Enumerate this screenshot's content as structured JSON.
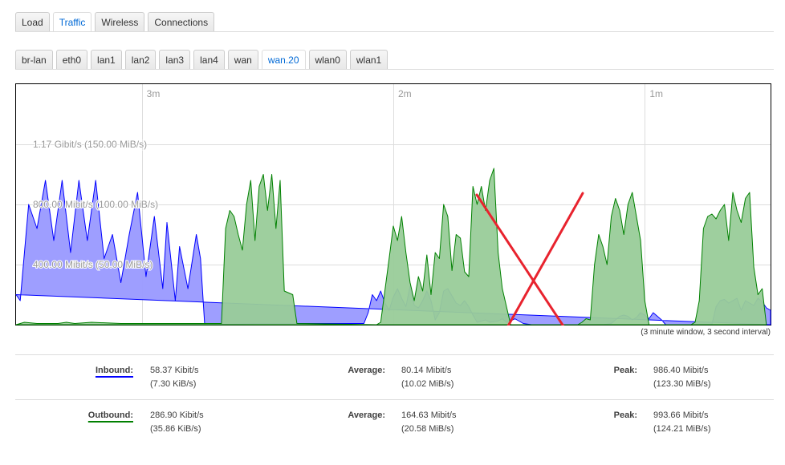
{
  "main_tabs": [
    "Load",
    "Traffic",
    "Wireless",
    "Connections"
  ],
  "main_active": "Traffic",
  "iface_tabs": [
    "br-lan",
    "eth0",
    "lan1",
    "lan2",
    "lan3",
    "lan4",
    "wan",
    "wan.20",
    "wlan0",
    "wlan1"
  ],
  "iface_active": "wan.20",
  "graph": {
    "caption": "(3 minute window, 3 second interval)",
    "colors": {
      "inbound_fill": "#9999ff",
      "inbound_line": "#0000ff",
      "outbound_fill": "#99cc99",
      "outbound_line": "#008000",
      "overlay_x": "#e8232e"
    }
  },
  "chart_data": {
    "type": "area",
    "x_unit": "seconds ago",
    "xlim": [
      180,
      0
    ],
    "x_ticks": [
      {
        "value": 150,
        "label": "3m"
      },
      {
        "value": 90,
        "label": "2m"
      },
      {
        "value": 30,
        "label": "1m"
      }
    ],
    "y_unit": "MiB/s",
    "ylim": [
      0,
      200
    ],
    "y_ticks": [
      {
        "value": 150,
        "label": "1.17 Gibit/s (150.00 MiB/s)"
      },
      {
        "value": 100,
        "label": "800.00 Mibit/s (100.00 MiB/s)"
      },
      {
        "value": 50,
        "label": "400.00 Mibit/s (50.00 MiB/s)"
      }
    ],
    "series": [
      {
        "name": "Inbound",
        "points": [
          [
            180,
            25
          ],
          [
            179,
            20
          ],
          [
            177,
            100
          ],
          [
            175,
            80
          ],
          [
            173,
            120
          ],
          [
            171,
            70
          ],
          [
            169,
            120
          ],
          [
            167,
            60
          ],
          [
            165,
            120
          ],
          [
            163,
            70
          ],
          [
            161,
            120
          ],
          [
            159,
            55
          ],
          [
            157,
            75
          ],
          [
            155,
            35
          ],
          [
            153,
            75
          ],
          [
            151,
            110
          ],
          [
            149,
            40
          ],
          [
            147,
            90
          ],
          [
            145,
            30
          ],
          [
            144,
            85
          ],
          [
            142,
            20
          ],
          [
            141,
            65
          ],
          [
            139,
            30
          ],
          [
            137,
            75
          ],
          [
            136,
            55
          ],
          [
            135,
            0
          ],
          [
            123,
            1
          ],
          [
            113,
            1
          ],
          [
            103,
            1
          ],
          [
            97,
            1
          ],
          [
            96,
            10
          ],
          [
            95,
            25
          ],
          [
            94,
            20
          ],
          [
            93,
            28
          ],
          [
            92,
            18
          ],
          [
            91,
            12
          ],
          [
            90,
            23
          ],
          [
            89,
            30
          ],
          [
            88,
            22
          ],
          [
            87,
            15
          ],
          [
            86,
            32
          ],
          [
            85,
            16
          ],
          [
            84,
            14
          ],
          [
            83,
            20
          ],
          [
            82,
            28
          ],
          [
            81,
            20
          ],
          [
            80,
            4
          ],
          [
            79,
            10
          ],
          [
            78,
            28
          ],
          [
            77,
            30
          ],
          [
            76,
            24
          ],
          [
            75,
            18
          ],
          [
            74,
            16
          ],
          [
            73,
            20
          ],
          [
            72,
            15
          ],
          [
            71,
            8
          ],
          [
            70,
            2
          ],
          [
            69,
            3
          ],
          [
            68,
            4
          ],
          [
            67,
            2
          ],
          [
            65,
            3
          ],
          [
            64,
            5
          ],
          [
            63,
            2
          ],
          [
            62,
            3
          ],
          [
            61,
            5
          ],
          [
            60,
            3
          ],
          [
            59,
            1
          ],
          [
            57,
            0
          ],
          [
            40,
            0
          ],
          [
            38,
            1
          ],
          [
            37,
            4
          ],
          [
            36,
            7
          ],
          [
            35,
            8
          ],
          [
            34,
            7
          ],
          [
            33,
            4
          ],
          [
            32,
            6
          ],
          [
            31,
            10
          ],
          [
            30,
            8
          ],
          [
            29,
            5
          ],
          [
            28,
            10
          ],
          [
            27,
            7
          ],
          [
            26,
            4
          ],
          [
            25,
            0
          ],
          [
            14,
            0
          ],
          [
            13,
            15
          ],
          [
            12,
            20
          ],
          [
            11,
            21
          ],
          [
            10,
            18
          ],
          [
            9,
            20
          ],
          [
            8,
            22
          ],
          [
            7,
            12
          ],
          [
            6,
            20
          ],
          [
            5,
            18
          ],
          [
            4,
            16
          ],
          [
            3,
            22
          ],
          [
            2,
            19
          ],
          [
            1,
            14
          ],
          [
            0,
            12
          ],
          [
            0,
            0
          ]
        ]
      },
      {
        "name": "Outbound",
        "points": [
          [
            180,
            0
          ],
          [
            178,
            2
          ],
          [
            175,
            1
          ],
          [
            170,
            1
          ],
          [
            168,
            2
          ],
          [
            166,
            1
          ],
          [
            162,
            2
          ],
          [
            155,
            1
          ],
          [
            153,
            1
          ],
          [
            131,
            1
          ],
          [
            130,
            80
          ],
          [
            129,
            95
          ],
          [
            128,
            90
          ],
          [
            127,
            75
          ],
          [
            126,
            62
          ],
          [
            125,
            100
          ],
          [
            124,
            120
          ],
          [
            123,
            70
          ],
          [
            122,
            115
          ],
          [
            121,
            125
          ],
          [
            120,
            95
          ],
          [
            119,
            125
          ],
          [
            118,
            80
          ],
          [
            117,
            120
          ],
          [
            116,
            28
          ],
          [
            114,
            25
          ],
          [
            113,
            1
          ],
          [
            94,
            0
          ],
          [
            93,
            2
          ],
          [
            91,
            55
          ],
          [
            90,
            82
          ],
          [
            89,
            70
          ],
          [
            88,
            90
          ],
          [
            87,
            60
          ],
          [
            86,
            35
          ],
          [
            85,
            20
          ],
          [
            84,
            40
          ],
          [
            83,
            28
          ],
          [
            82,
            58
          ],
          [
            81,
            25
          ],
          [
            80,
            60
          ],
          [
            79,
            55
          ],
          [
            78,
            100
          ],
          [
            77,
            90
          ],
          [
            76,
            45
          ],
          [
            75,
            75
          ],
          [
            74,
            72
          ],
          [
            73,
            44
          ],
          [
            72,
            40
          ],
          [
            71,
            115
          ],
          [
            70,
            100
          ],
          [
            69,
            115
          ],
          [
            68,
            95
          ],
          [
            67,
            120
          ],
          [
            66,
            130
          ],
          [
            65,
            60
          ],
          [
            64,
            30
          ],
          [
            63,
            15
          ],
          [
            62,
            0
          ],
          [
            46,
            0
          ],
          [
            45,
            2
          ],
          [
            44,
            5
          ],
          [
            43,
            4
          ],
          [
            42,
            50
          ],
          [
            41,
            75
          ],
          [
            40,
            65
          ],
          [
            39,
            50
          ],
          [
            38,
            90
          ],
          [
            37,
            105
          ],
          [
            36,
            95
          ],
          [
            35,
            75
          ],
          [
            34,
            100
          ],
          [
            33,
            110
          ],
          [
            32,
            90
          ],
          [
            31,
            70
          ],
          [
            30,
            20
          ],
          [
            29,
            0
          ],
          [
            19,
            0
          ],
          [
            18,
            2
          ],
          [
            17,
            20
          ],
          [
            16,
            80
          ],
          [
            15,
            90
          ],
          [
            14,
            92
          ],
          [
            13,
            88
          ],
          [
            12,
            95
          ],
          [
            11,
            100
          ],
          [
            10,
            70
          ],
          [
            9,
            110
          ],
          [
            8,
            95
          ],
          [
            7,
            85
          ],
          [
            6,
            105
          ],
          [
            5,
            110
          ],
          [
            4,
            48
          ],
          [
            3,
            25
          ],
          [
            2,
            30
          ],
          [
            1,
            0
          ]
        ]
      }
    ]
  },
  "stats": {
    "inbound": {
      "label": "Inbound:",
      "cur": "58.37 Kibit/s",
      "cur2": "(7.30 KiB/s)",
      "avg_label": "Average:",
      "avg": "80.14 Mibit/s",
      "avg2": "(10.02 MiB/s)",
      "peak_label": "Peak:",
      "peak": "986.40 Mibit/s",
      "peak2": "(123.30 MiB/s)"
    },
    "outbound": {
      "label": "Outbound:",
      "cur": "286.90 Kibit/s",
      "cur2": "(35.86 KiB/s)",
      "avg_label": "Average:",
      "avg": "164.63 Mibit/s",
      "avg2": "(20.58 MiB/s)",
      "peak_label": "Peak:",
      "peak": "993.66 Mibit/s",
      "peak2": "(124.21 MiB/s)"
    }
  }
}
